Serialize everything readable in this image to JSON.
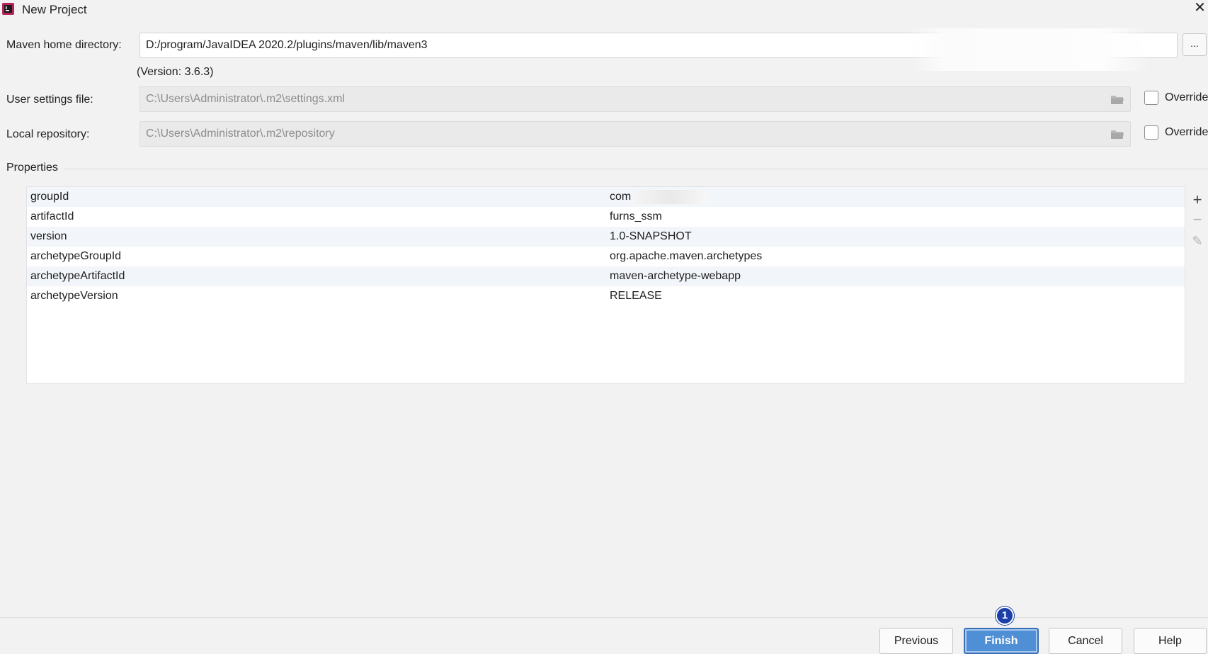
{
  "window": {
    "title": "New Project",
    "close_symbol": "✕"
  },
  "maven_home": {
    "label": "Maven home directory:",
    "value": "D:/program/JavaIDEA 2020.2/plugins/maven/lib/maven3",
    "browse_label": "..."
  },
  "version_note": "(Version: 3.6.3)",
  "user_settings": {
    "label": "User settings file:",
    "value": "C:\\Users\\Administrator\\.m2\\settings.xml",
    "override_label": "Override",
    "override_checked": false
  },
  "local_repo": {
    "label": "Local repository:",
    "value": "C:\\Users\\Administrator\\.m2\\repository",
    "override_label": "Override",
    "override_checked": false
  },
  "properties": {
    "title": "Properties",
    "rows": [
      {
        "key": "groupId",
        "value": "com"
      },
      {
        "key": "artifactId",
        "value": "furns_ssm"
      },
      {
        "key": "version",
        "value": "1.0-SNAPSHOT"
      },
      {
        "key": "archetypeGroupId",
        "value": "org.apache.maven.archetypes"
      },
      {
        "key": "archetypeArtifactId",
        "value": "maven-archetype-webapp"
      },
      {
        "key": "archetypeVersion",
        "value": "RELEASE"
      }
    ],
    "tools": {
      "add": "+",
      "remove": "−",
      "edit": "✎"
    }
  },
  "buttons": {
    "previous": "Previous",
    "finish": "Finish",
    "cancel": "Cancel",
    "help": "Help"
  },
  "step_badge": "1",
  "colors": {
    "accent": "#4f8fd6",
    "badge": "#1a3fa8",
    "background": "#f2f2f2"
  },
  "icons": {
    "app": "intellij-app-icon",
    "folder": "folder-icon",
    "close": "close-icon"
  }
}
